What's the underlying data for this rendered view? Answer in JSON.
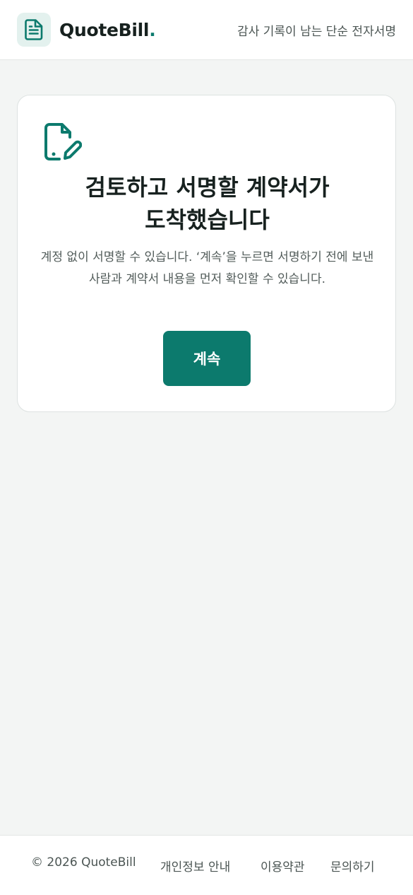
{
  "header": {
    "brand_name": "QuoteBill",
    "brand_dot": ".",
    "tagline": "감사 기록이 남는 단순 전자서명",
    "logo_icon": "document-icon"
  },
  "card": {
    "icon": "file-signature-icon",
    "title_line1": "검토하고 서명할 계약서가",
    "title_line2": "도착했습니다",
    "description": "계정 없이 서명할 수 있습니다. ‘계속’을 누르면 서명하기 전에 보낸 사람과 계약서 내용을 먼저 확인할 수 있습니다.",
    "continue_label": "계속"
  },
  "footer": {
    "copyright": "© 2026 QuoteBill",
    "links": [
      {
        "label": "개인정보 안내"
      },
      {
        "label": "이용약관"
      },
      {
        "label": "문의하기"
      }
    ]
  },
  "colors": {
    "accent": "#0c7a6d",
    "accent_light": "#e3f1ee",
    "background": "#f3f5f4"
  }
}
